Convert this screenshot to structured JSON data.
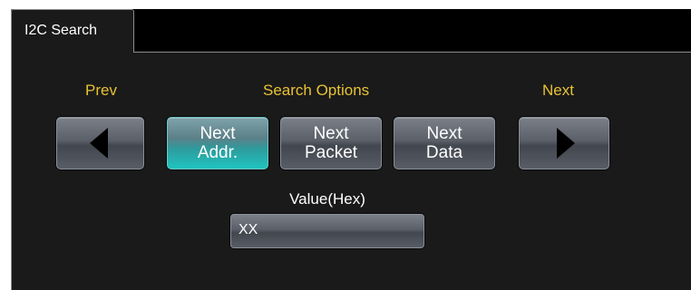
{
  "tab": {
    "title": "I2C Search"
  },
  "labels": {
    "prev": "Prev",
    "search_options": "Search Options",
    "next": "Next"
  },
  "buttons": {
    "prev_icon": "left-arrow-icon",
    "next_icon": "right-arrow-icon",
    "next_addr": {
      "line1": "Next",
      "line2": "Addr.",
      "selected": true
    },
    "next_packet": {
      "line1": "Next",
      "line2": "Packet",
      "selected": false
    },
    "next_data": {
      "line1": "Next",
      "line2": "Data",
      "selected": false
    }
  },
  "value_field": {
    "label": "Value(Hex)",
    "value": "XX"
  },
  "colors": {
    "label_yellow": "#e8c233",
    "selected_teal": "#1fc4c0",
    "background": "#1a1a1a"
  }
}
